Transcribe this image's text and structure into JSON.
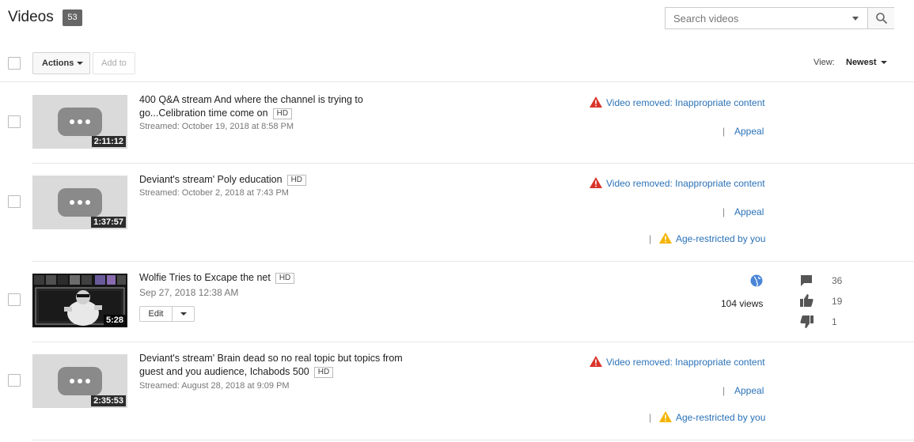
{
  "header": {
    "title": "Videos",
    "count": "53",
    "search_placeholder": "Search videos"
  },
  "toolbar": {
    "actions_label": "Actions",
    "add_to_label": "Add to",
    "view_label": "View:",
    "view_value": "Newest"
  },
  "videos": [
    {
      "title_line1": "400 Q&A stream And where the channel is trying to",
      "title_line2": "go...Celibration time come on",
      "hd": "HD",
      "duration": "2:11:12",
      "subtitle": "Streamed: October 19, 2018 at 8:58 PM",
      "status": "Video removed: Inappropriate content",
      "pipe": "|",
      "appeal": "Appeal"
    },
    {
      "title_line1": "Deviant's stream' Poly education",
      "hd": "HD",
      "duration": "1:37:57",
      "subtitle": "Streamed: October 2, 2018 at 7:43 PM",
      "status": "Video removed: Inappropriate content",
      "pipe": "|",
      "appeal": "Appeal",
      "age_restricted": "Age-restricted by you"
    },
    {
      "title_line1": "Wolfie Tries to Excape the net",
      "hd": "HD",
      "duration": "5:28",
      "subtitle": "Sep 27, 2018 12:38 AM",
      "edit_label": "Edit",
      "views": "104 views",
      "comments": "36",
      "likes": "19",
      "dislikes": "1"
    },
    {
      "title_line1": "Deviant's stream' Brain dead so no real topic but topics from",
      "title_line2": "guest and you audience, Ichabods 500",
      "hd": "HD",
      "duration": "2:35:53",
      "subtitle": "Streamed: August 28, 2018 at 9:09 PM",
      "status": "Video removed: Inappropriate content",
      "pipe": "|",
      "appeal": "Appeal",
      "age_restricted": "Age-restricted by you"
    }
  ],
  "icons": {
    "warning": "warning-icon",
    "age_warning": "age-restricted-icon",
    "public": "globe-icon",
    "comment": "comment-icon",
    "like": "thumbs-up-icon",
    "dislike": "thumbs-down-icon",
    "search": "search-icon"
  },
  "colors": {
    "link": "#2a72b8",
    "removed_warning": "#d9342b",
    "age_warning": "#f4b400",
    "globe": "#4a86d8",
    "badge": "#666666"
  }
}
